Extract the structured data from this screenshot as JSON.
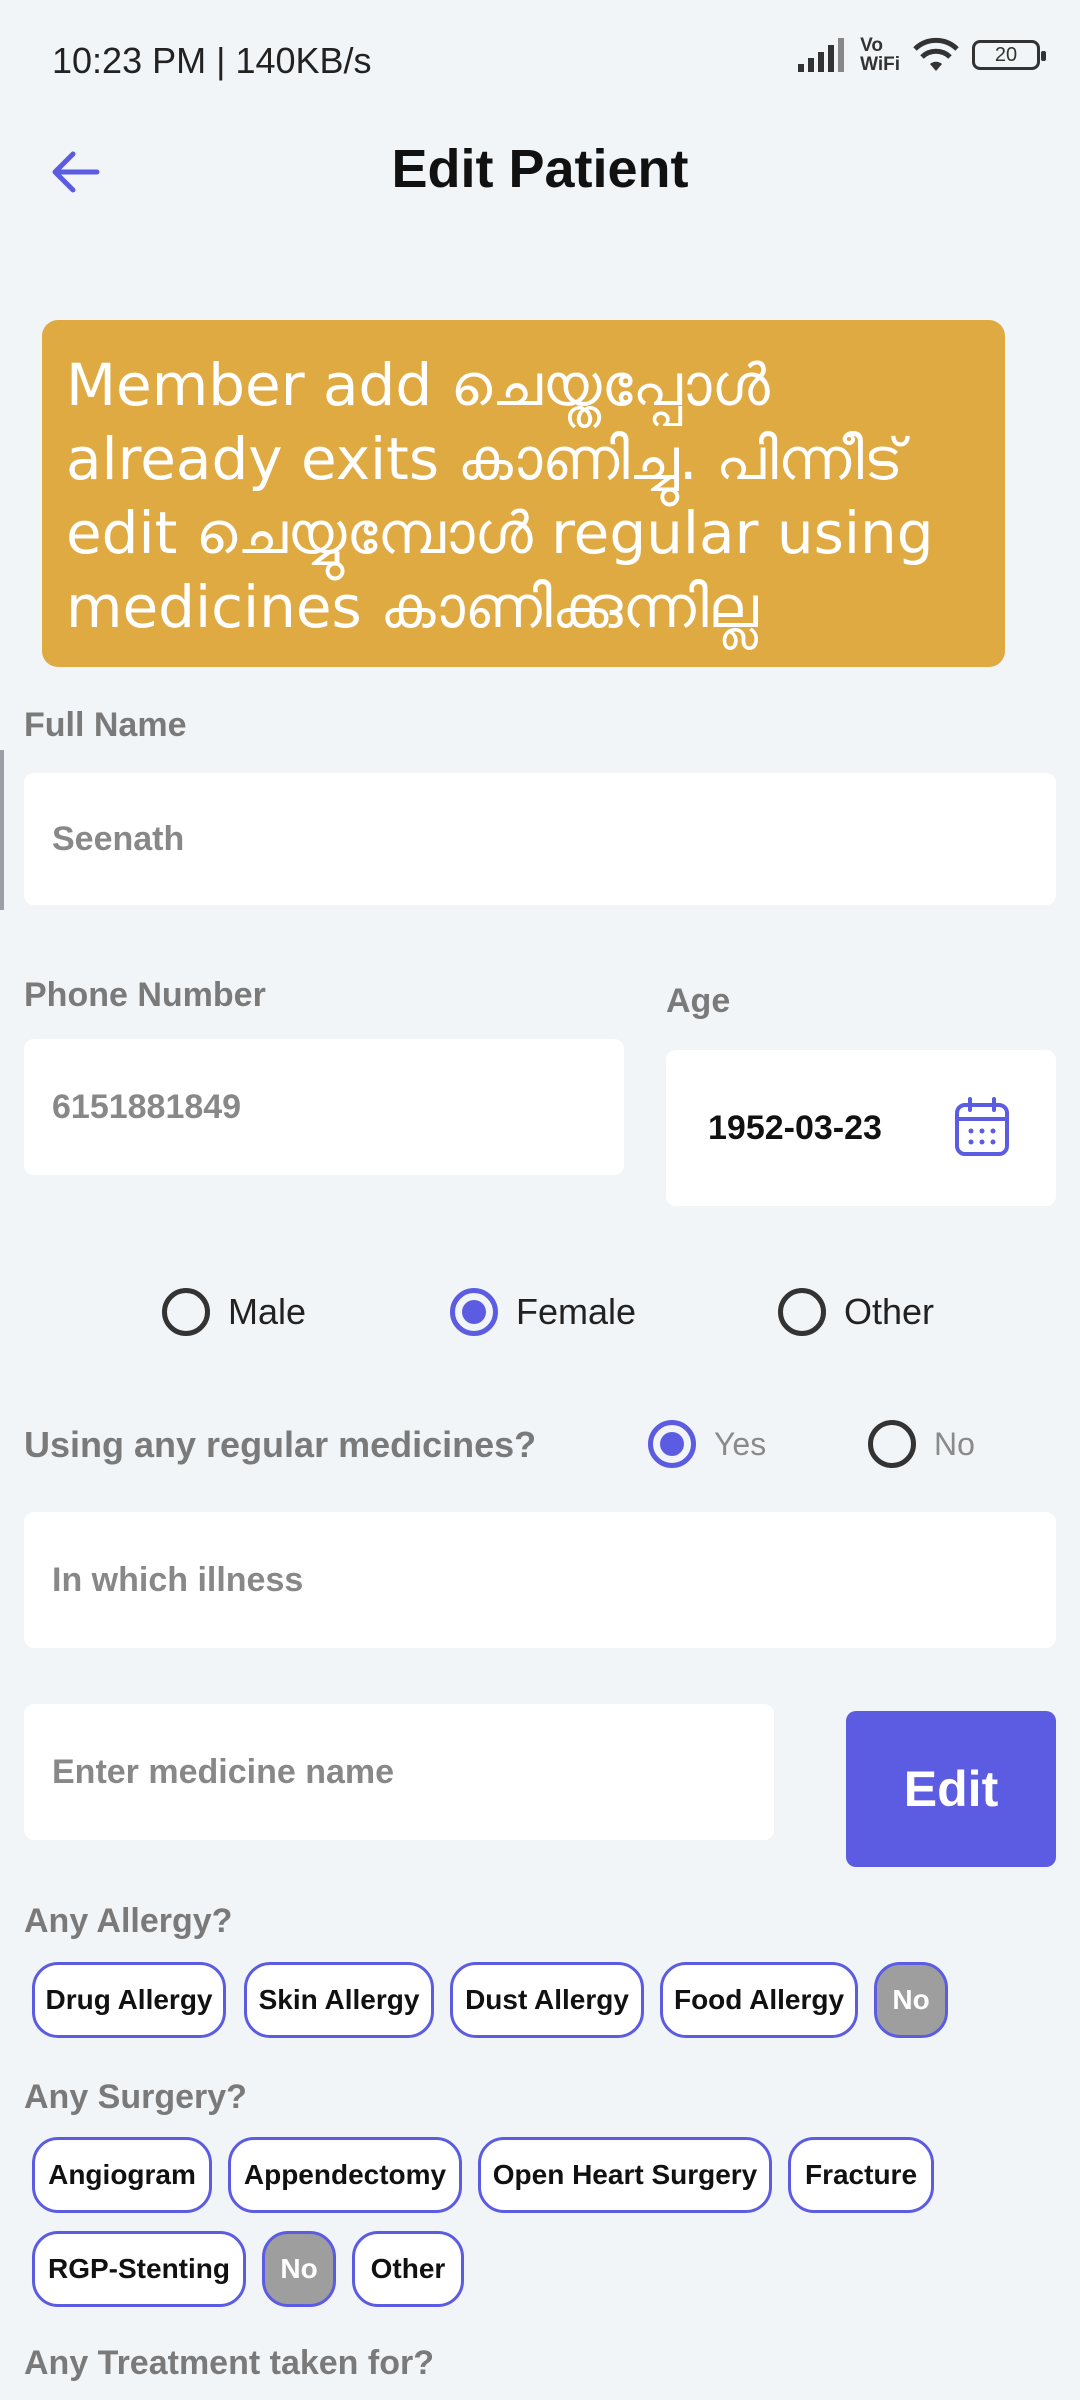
{
  "status": {
    "time": "10:23 PM | 140KB/s",
    "vowifi_top": "Vo",
    "vowifi_bottom": "WiFi",
    "battery": "20"
  },
  "header": {
    "title": "Edit Patient"
  },
  "banner": {
    "text": "Member add ചെയ്തപ്പോൾ already exits കാണിച്ചു. പിന്നീട് edit ചെയ്യുമ്പോൾ regular using medicines കാണിക്കുന്നില്ല"
  },
  "form": {
    "full_name_label": "Full Name",
    "full_name_value": "Seenath",
    "phone_label": "Phone Number",
    "phone_value": "6151881849",
    "age_label": "Age",
    "age_value": "1952-03-23",
    "gender": {
      "options": [
        "Male",
        "Female",
        "Other"
      ],
      "selected": "Female"
    },
    "medicines_question": "Using any regular medicines?",
    "medicines_options": [
      "Yes",
      "No"
    ],
    "medicines_selected": "Yes",
    "illness_placeholder": "In which illness",
    "medicine_placeholder": "Enter medicine name",
    "edit_button": "Edit",
    "allergy_label": "Any Allergy?",
    "allergy_options": [
      "Drug Allergy",
      "Skin Allergy",
      "Dust Allergy",
      "Food Allergy",
      "No"
    ],
    "allergy_selected": "No",
    "surgery_label": "Any Surgery?",
    "surgery_options": [
      "Angiogram",
      "Appendectomy",
      "Open Heart Surgery",
      "Fracture",
      "RGP-Stenting",
      "No",
      "Other"
    ],
    "surgery_selected": "No",
    "treatment_label": "Any Treatment taken for?"
  },
  "colors": {
    "accent": "#5b5ce2",
    "banner": "#e0aa43",
    "background": "#f2f5f7",
    "chip_selected": "#9e9e9e"
  }
}
